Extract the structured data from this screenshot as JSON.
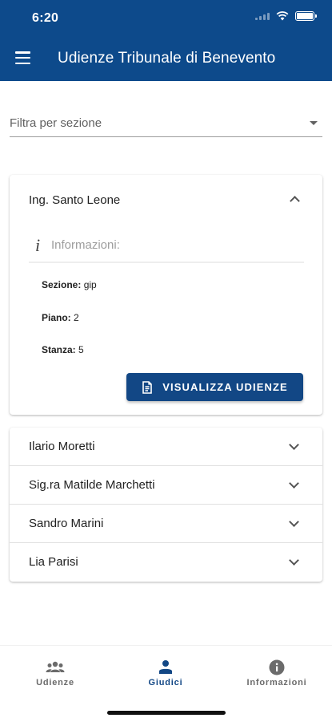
{
  "status_bar": {
    "time": "6:20"
  },
  "app_bar": {
    "title": "Udienze Tribunale di Benevento"
  },
  "filter": {
    "placeholder": "Filtra per sezione"
  },
  "expanded_judge": {
    "name": "Ing. Santo Leone",
    "info_label": "Informazioni:",
    "details": [
      {
        "label": "Sezione:",
        "value": "gip"
      },
      {
        "label": "Piano:",
        "value": "2"
      },
      {
        "label": "Stanza:",
        "value": "5"
      }
    ],
    "button_label": "VISUALIZZA UDIENZE"
  },
  "judges": [
    {
      "name": "Ilario Moretti"
    },
    {
      "name": "Sig.ra Matilde Marchetti"
    },
    {
      "name": "Sandro Marini"
    },
    {
      "name": "Lia Parisi"
    }
  ],
  "bottom_nav": [
    {
      "label": "Udienze",
      "icon": "group-icon",
      "active": false
    },
    {
      "label": "Giudici",
      "icon": "person-icon",
      "active": true
    },
    {
      "label": "Informazioni",
      "icon": "info-icon",
      "active": false
    }
  ],
  "colors": {
    "primary": "#0d4a8b",
    "button": "#124785"
  }
}
